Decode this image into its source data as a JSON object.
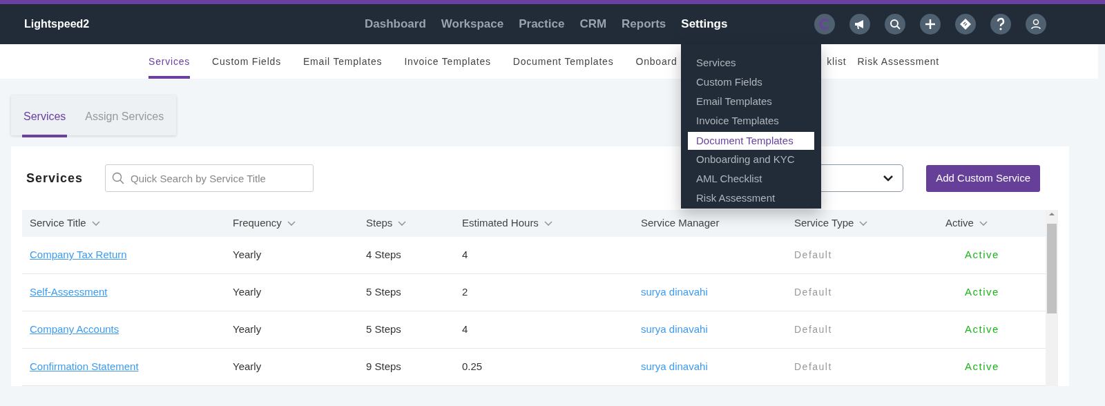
{
  "brand": "Lightspeed2",
  "nav": [
    {
      "label": "Dashboard",
      "selected": false
    },
    {
      "label": "Workspace",
      "selected": false
    },
    {
      "label": "Practice",
      "selected": false
    },
    {
      "label": "CRM",
      "selected": false
    },
    {
      "label": "Reports",
      "selected": false
    },
    {
      "label": "Settings",
      "selected": true
    }
  ],
  "subnav": [
    {
      "label": "Services",
      "selected": true
    },
    {
      "label": "Custom Fields",
      "selected": false
    },
    {
      "label": "Email Templates",
      "selected": false
    },
    {
      "label": "Invoice Templates",
      "selected": false
    },
    {
      "label": "Document Templates",
      "selected": false
    },
    {
      "label": "Onboard",
      "selected": false
    },
    {
      "label": "klist",
      "selected": false
    },
    {
      "label": "Risk Assessment",
      "selected": false
    }
  ],
  "settings_menu": [
    {
      "label": "Services",
      "selected": false
    },
    {
      "label": "Custom Fields",
      "selected": false
    },
    {
      "label": "Email Templates",
      "selected": false
    },
    {
      "label": "Invoice Templates",
      "selected": false
    },
    {
      "label": "Document Templates",
      "selected": true
    },
    {
      "label": "Onboarding and KYC",
      "selected": false
    },
    {
      "label": "AML Checklist",
      "selected": false
    },
    {
      "label": "Risk Assessment",
      "selected": false
    }
  ],
  "tabs": [
    {
      "label": "Services",
      "selected": true
    },
    {
      "label": "Assign Services",
      "selected": false
    }
  ],
  "panel": {
    "title": "Services",
    "search": {
      "placeholder": "Quick Search by Service Title"
    },
    "add_button": "Add Custom Service"
  },
  "table": {
    "columns": [
      {
        "label": "Service Title",
        "sortable": true
      },
      {
        "label": "Frequency",
        "sortable": true
      },
      {
        "label": "Steps",
        "sortable": true
      },
      {
        "label": "Estimated Hours",
        "sortable": true
      },
      {
        "label": "Service Manager",
        "sortable": false
      },
      {
        "label": "Service Type",
        "sortable": true
      },
      {
        "label": "Active",
        "sortable": true
      }
    ],
    "rows": [
      {
        "title": "Company Tax Return",
        "frequency": "Yearly",
        "steps": "4 Steps",
        "hours": "4",
        "type": "Default",
        "status": "Active"
      },
      {
        "title": "Self-Assessment",
        "frequency": "Yearly",
        "steps": "5 Steps",
        "hours": "2",
        "manager": "surya dinavahi",
        "type": "Default",
        "status": "Active"
      },
      {
        "title": "Company Accounts",
        "frequency": "Yearly",
        "steps": "5 Steps",
        "hours": "4",
        "manager": "surya dinavahi",
        "type": "Default",
        "status": "Active"
      },
      {
        "title": "Confirmation Statement",
        "frequency": "Yearly",
        "steps": "9 Steps",
        "hours": "0.25",
        "manager": "surya dinavahi",
        "type": "Default",
        "status": "Active"
      }
    ]
  }
}
